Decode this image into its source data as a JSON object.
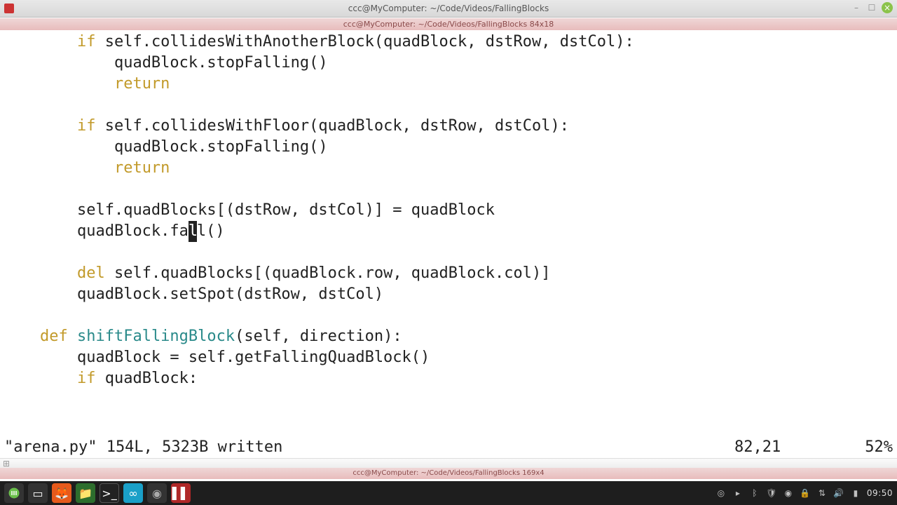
{
  "window": {
    "title": "ccc@MyComputer: ~/Code/Videos/FallingBlocks",
    "tmux_title_1": "ccc@MyComputer: ~/Code/Videos/FallingBlocks 84x18",
    "tmux_title_2": "ccc@MyComputer: ~/Code/Videos/FallingBlocks 169x4"
  },
  "code": {
    "l1": {
      "indent": "        ",
      "kw": "if",
      "rest": " self.collidesWithAnotherBlock(quadBlock, dstRow, dstCol):"
    },
    "l2": {
      "indent": "            ",
      "rest": "quadBlock.stopFalling()"
    },
    "l3": {
      "indent": "            ",
      "kw": "return",
      "rest": ""
    },
    "l4": "",
    "l5": {
      "indent": "        ",
      "kw": "if",
      "rest": " self.collidesWithFloor(quadBlock, dstRow, dstCol):"
    },
    "l6": {
      "indent": "            ",
      "rest": "quadBlock.stopFalling()"
    },
    "l7": {
      "indent": "            ",
      "kw": "return",
      "rest": ""
    },
    "l8": "",
    "l9": {
      "indent": "        ",
      "rest": "self.quadBlocks[(dstRow, dstCol)] = quadBlock"
    },
    "l10a": {
      "indent": "        ",
      "pre": "quadBlock.fa",
      "cur": "l",
      "post": "l()"
    },
    "l11": "",
    "l12": {
      "indent": "        ",
      "kw": "del",
      "rest": " self.quadBlocks[(quadBlock.row, quadBlock.col)]"
    },
    "l13": {
      "indent": "        ",
      "rest": "quadBlock.setSpot(dstRow, dstCol)"
    },
    "l14": "",
    "l15": {
      "indent": "    ",
      "kw": "def",
      "fn": " shiftFallingBlock",
      "rest": "(self, direction):"
    },
    "l16": {
      "indent": "        ",
      "rest": "quadBlock = self.getFallingQuadBlock()"
    },
    "l17": {
      "indent": "        ",
      "kw": "if",
      "rest": " quadBlock:"
    }
  },
  "vim_status": {
    "message": "\"arena.py\" 154L, 5323B written",
    "position": "82,21",
    "percent": "52%"
  },
  "prompt": {
    "user": "ccc",
    "at": "@",
    "host": "MyComputer",
    "colon": ":",
    "path": "~/Code/Videos/FallingBlocks",
    "dollar": "$"
  },
  "taskbar": {
    "clock": "09:50",
    "tray": [
      "obs",
      "bluetooth",
      "wifi",
      "shield",
      "lock",
      "network",
      "volume",
      "battery"
    ]
  }
}
